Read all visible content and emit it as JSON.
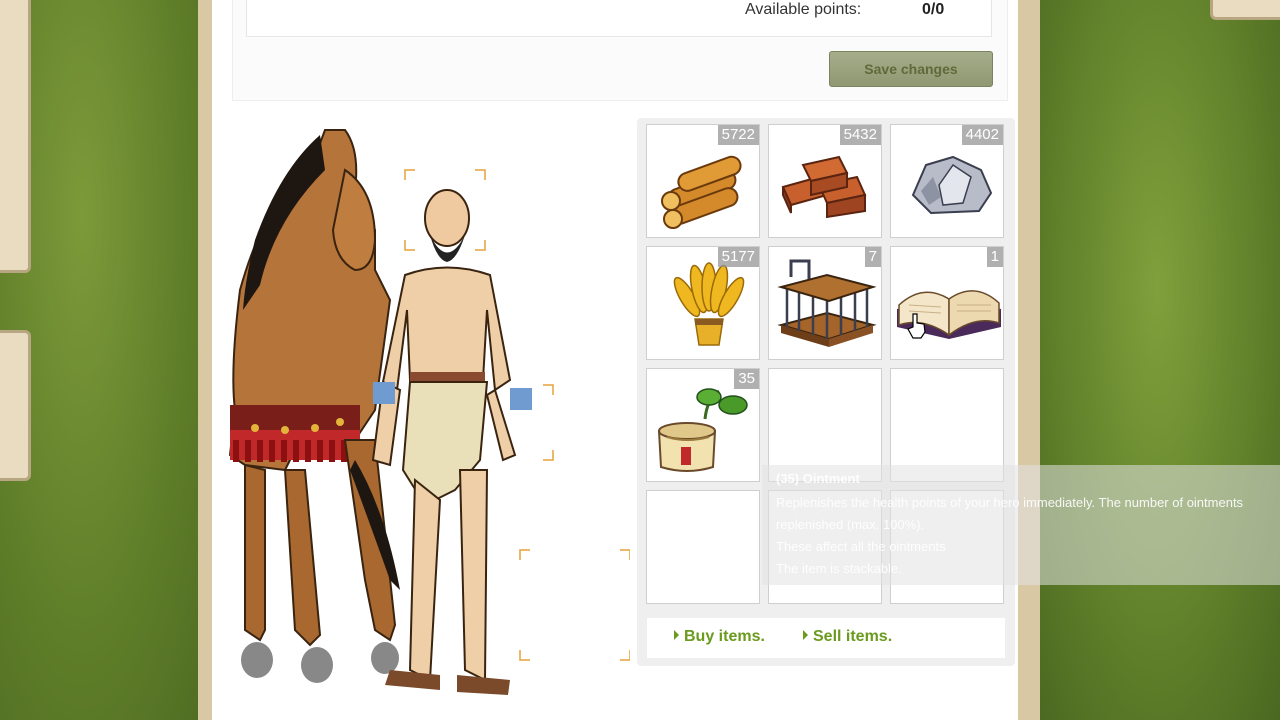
{
  "attributes": {
    "available_label": "Available points:",
    "available_value": "0/0",
    "save_label": "Save changes"
  },
  "inventory": {
    "slots": [
      {
        "item": "wood",
        "icon": "logs-icon",
        "count": "5722"
      },
      {
        "item": "clay",
        "icon": "bricks-icon",
        "count": "5432"
      },
      {
        "item": "iron",
        "icon": "stone-icon",
        "count": "4402"
      },
      {
        "item": "wheat",
        "icon": "wheat-icon",
        "count": "5177"
      },
      {
        "item": "cage",
        "icon": "cage-icon",
        "count": "7"
      },
      {
        "item": "book",
        "icon": "book-icon",
        "count": "1"
      },
      {
        "item": "ointment",
        "icon": "ointment-icon",
        "count": "35"
      },
      {
        "item": "",
        "icon": "",
        "count": ""
      },
      {
        "item": "",
        "icon": "",
        "count": ""
      },
      {
        "item": "",
        "icon": "",
        "count": ""
      },
      {
        "item": "",
        "icon": "",
        "count": ""
      },
      {
        "item": "",
        "icon": "",
        "count": ""
      }
    ],
    "buy_label": "Buy items.",
    "sell_label": "Sell items."
  },
  "tooltip": {
    "title": "(35) Ointment",
    "line1": "Replenishes the health points of your hero immediately. The number of ointments",
    "line2": "replenished (max. 100%).",
    "line3": "These affect all the ointments",
    "line4": "The item is stackable."
  },
  "colors": {
    "accent_link": "#6a9a1e",
    "frame": "#d9c8a4",
    "button": "#a6ad8a"
  }
}
